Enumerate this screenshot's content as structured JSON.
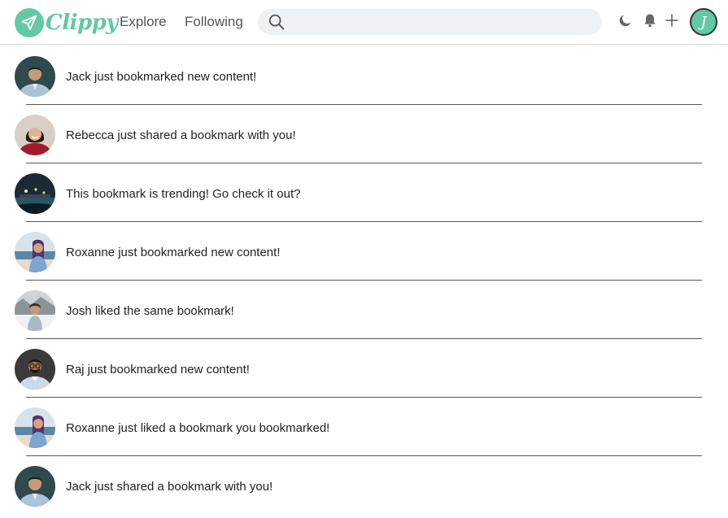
{
  "header": {
    "logo_text": "Clippy",
    "nav": {
      "explore_label": "Explore",
      "following_label": "Following"
    },
    "search": {
      "placeholder": ""
    },
    "avatar_initial": "J",
    "brand_color": "#62c9a3"
  },
  "notifications": [
    {
      "text": "Jack just bookmarked new content!",
      "avatar": "man-blue-shirt"
    },
    {
      "text": "Rebecca just shared a bookmark with you!",
      "avatar": "woman-red-top"
    },
    {
      "text": "This bookmark is trending! Go check it out?",
      "avatar": "night-city"
    },
    {
      "text": "Roxanne just bookmarked new content!",
      "avatar": "woman-beach"
    },
    {
      "text": "Josh liked the same bookmark!",
      "avatar": "person-snow"
    },
    {
      "text": "Raj just bookmarked new content!",
      "avatar": "man-glasses"
    },
    {
      "text": "Roxanne just liked a bookmark you bookmarked!",
      "avatar": "woman-beach"
    },
    {
      "text": "Jack just shared a bookmark with you!",
      "avatar": "man-blue-shirt"
    }
  ]
}
